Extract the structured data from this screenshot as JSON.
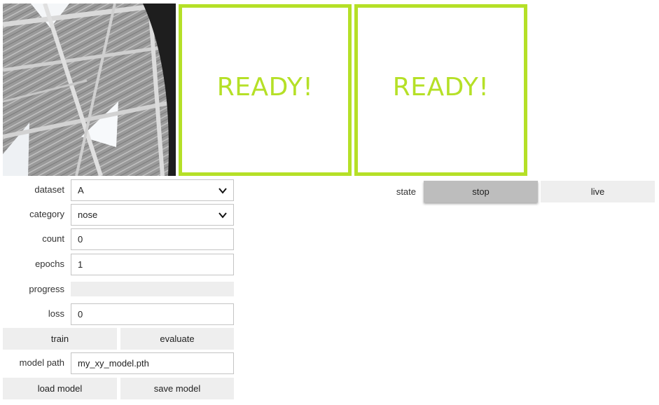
{
  "camera": {
    "icon": "camera-image"
  },
  "panels": [
    {
      "text": "READY!"
    },
    {
      "text": "READY!"
    }
  ],
  "form": {
    "dataset": {
      "label": "dataset",
      "value": "A"
    },
    "category": {
      "label": "category",
      "value": "nose"
    },
    "count": {
      "label": "count",
      "value": "0"
    },
    "epochs": {
      "label": "epochs",
      "value": "1"
    },
    "progress": {
      "label": "progress",
      "value": 0
    },
    "loss": {
      "label": "loss",
      "value": "0"
    },
    "train_label": "train",
    "evaluate_label": "evaluate",
    "model_path": {
      "label": "model path",
      "value": "my_xy_model.pth"
    },
    "load_label": "load model",
    "save_label": "save model"
  },
  "state": {
    "label": "state",
    "options": [
      "stop",
      "live"
    ],
    "selected": "stop"
  },
  "colors": {
    "accent": "#b5e027",
    "button": "#eeeeee",
    "button_active": "#bdbdbd"
  }
}
